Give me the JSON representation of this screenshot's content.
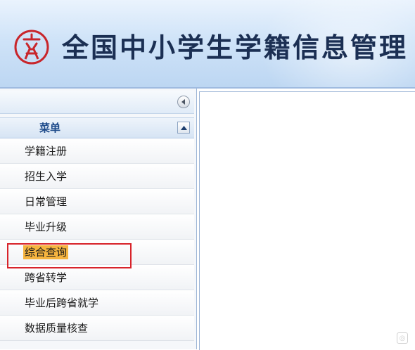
{
  "header": {
    "title": "全国中小学生学籍信息管理",
    "logo_icon": "school-seal-logo",
    "logo_color": "#c8262c",
    "title_color": "#1b2f53"
  },
  "sidebar": {
    "collapse_icon": "circle-left-arrow-icon",
    "menu_title": "菜单",
    "menu_toggle_icon": "chevron-up-icon",
    "items": [
      {
        "label": "学籍注册"
      },
      {
        "label": "招生入学"
      },
      {
        "label": "日常管理"
      },
      {
        "label": "毕业升级"
      },
      {
        "label": "综合查询",
        "highlighted": true
      },
      {
        "label": "跨省转学"
      },
      {
        "label": "毕业后跨省就学"
      },
      {
        "label": "数据质量核查"
      }
    ],
    "highlight_color": "#f6b43f",
    "annotation_box_color": "#d8232a"
  }
}
